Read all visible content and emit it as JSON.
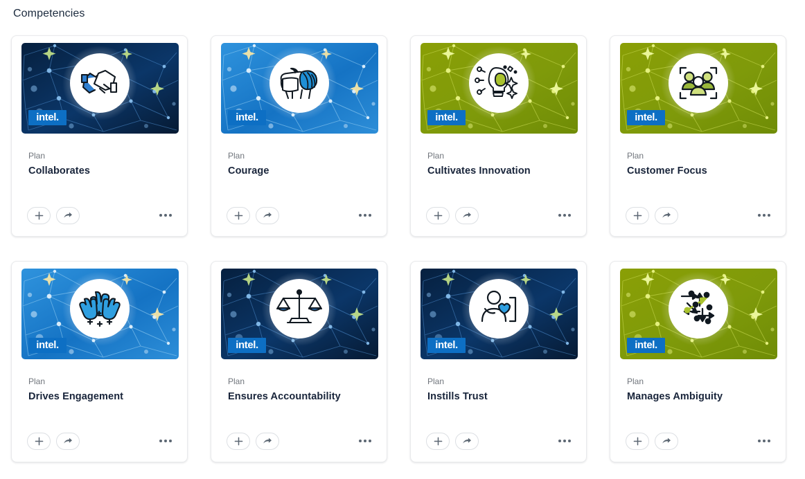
{
  "page": {
    "title": "Competencies"
  },
  "icons": {
    "add": "plus-icon",
    "share": "share-arrow-icon",
    "more": "more-options-icon",
    "brand": "intel-logo"
  },
  "brand": {
    "wordmark": "intel",
    "dot": "."
  },
  "actions": {
    "add_label": "Add",
    "share_label": "Share",
    "more_label": "More options"
  },
  "cards": [
    {
      "kicker": "Plan",
      "title": "Collaborates",
      "icon": "handshake-icon",
      "theme": "navy",
      "logo_position": "low"
    },
    {
      "kicker": "Plan",
      "title": "Courage",
      "icon": "lion-icon",
      "theme": "bright-blue",
      "logo_position": "low"
    },
    {
      "kicker": "Plan",
      "title": "Cultivates Innovation",
      "icon": "lightbulb-brain-icon",
      "theme": "green",
      "logo_position": "low"
    },
    {
      "kicker": "Plan",
      "title": "Customer Focus",
      "icon": "people-focus-icon",
      "theme": "green",
      "logo_position": "low"
    },
    {
      "kicker": "Plan",
      "title": "Drives Engagement",
      "icon": "raised-hands-icon",
      "theme": "bright-blue",
      "logo_position": "base"
    },
    {
      "kicker": "Plan",
      "title": "Ensures Accountability",
      "icon": "balance-scales-icon",
      "theme": "navy",
      "logo_position": "base"
    },
    {
      "kicker": "Plan",
      "title": "Instills Trust",
      "icon": "person-heart-icon",
      "theme": "navy",
      "logo_position": "base"
    },
    {
      "kicker": "Plan",
      "title": "Manages Ambiguity",
      "icon": "multi-direction-arrows-icon",
      "theme": "green",
      "logo_position": "base"
    }
  ],
  "colors": {
    "intel_blue": "#0d6fc4",
    "navy_dark": "#0b2545",
    "bright_blue": "#1f7fd0",
    "green": "#7f9c0b",
    "title_text": "#18243a",
    "kicker_text": "#70757c",
    "card_border": "#e9eaec"
  }
}
